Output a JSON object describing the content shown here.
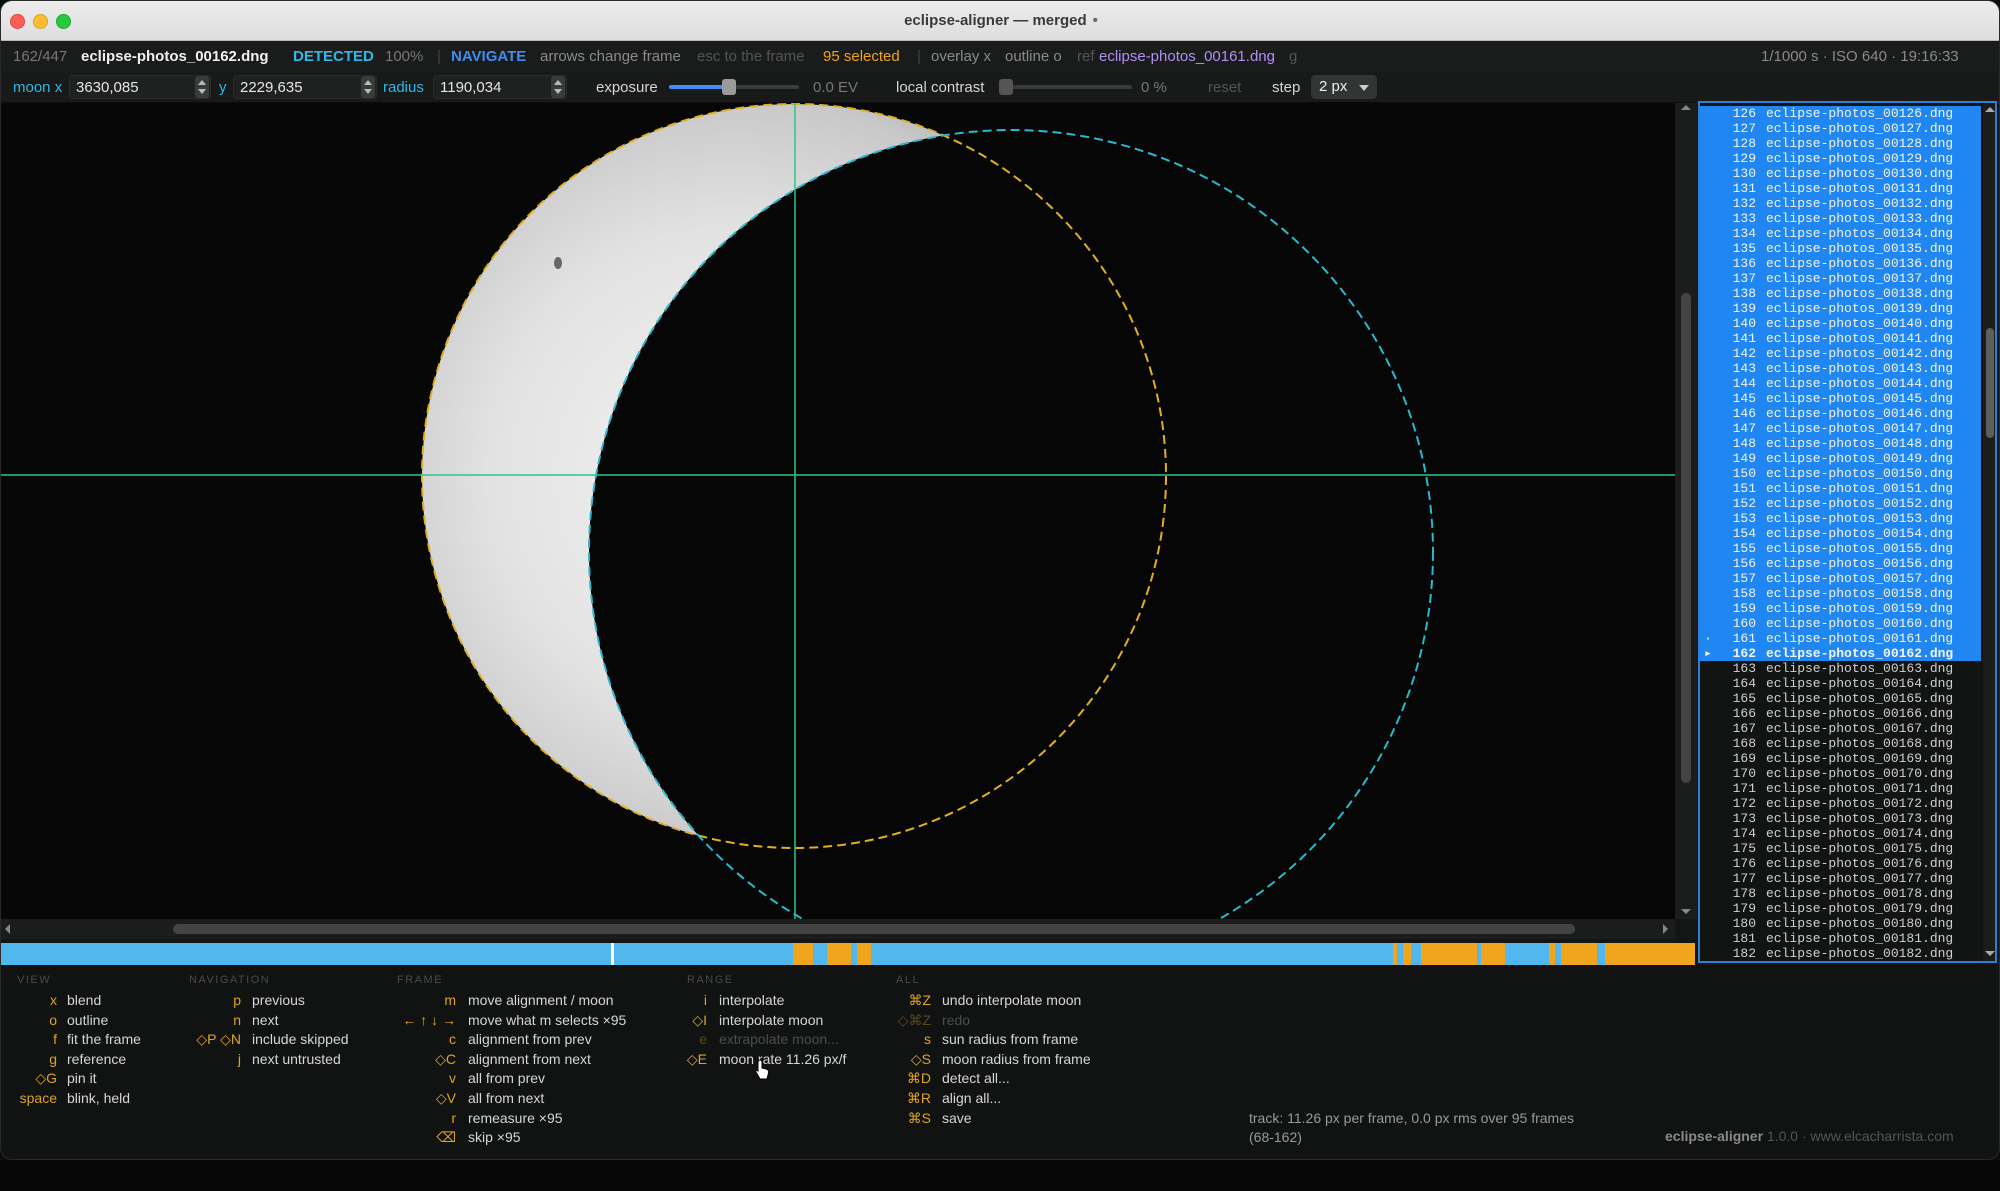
{
  "window": {
    "title": "eclipse-aligner — merged",
    "modified_dot": "•"
  },
  "status": {
    "counter": "162/447",
    "filename": "eclipse-photos_00162.dng",
    "detect_state": "DETECTED",
    "zoom": "100%",
    "mode": "NAVIGATE",
    "hint_arrows": "arrows change frame",
    "hint_esc": "esc to the frame",
    "selected": "95 selected",
    "overlay": "overlay x",
    "outline": "outline o",
    "ref_label": "ref",
    "ref_file": "eclipse-photos_00161.dng",
    "ref_key": "g",
    "exif": "1/1000 s · ISO 640 · 19:16:33"
  },
  "controls": {
    "moonx_label": "moon x",
    "moonx_value": "3630,085",
    "y_label": "y",
    "y_value": "2229,635",
    "radius_label": "radius",
    "radius_value": "1190,034",
    "exposure_label": "exposure",
    "exposure_value": "0.0 EV",
    "exposure_level": 0.5,
    "contrast_label": "local contrast",
    "contrast_value": "0 %",
    "contrast_level": 0,
    "reset_label": "reset",
    "step_label": "step",
    "step_value": "2 px"
  },
  "colors": {
    "sun_outline": "#e0b024",
    "moon_outline": "#2ab8cc",
    "crosshair": "#27c985",
    "accent": "#1f86f2",
    "strip_base": "#50b8ec",
    "strip_mark": "#f0a51e"
  },
  "files": {
    "start": 126,
    "end": 182,
    "prefix": "eclipse-photos_00",
    "ext": ".dng",
    "selected_from": 126,
    "selected_to": 162,
    "current": 162,
    "reference": 161
  },
  "help": {
    "sections": [
      {
        "title": "VIEW",
        "items": [
          {
            "key": "x",
            "desc": "blend"
          },
          {
            "key": "o",
            "desc": "outline"
          },
          {
            "key": "f",
            "desc": "fit the frame"
          },
          {
            "key": "g",
            "desc": "reference"
          },
          {
            "key": "◇G",
            "desc": "pin it"
          },
          {
            "key": "space",
            "desc": "blink, held"
          }
        ]
      },
      {
        "title": "NAVIGATION",
        "items": [
          {
            "key": "p",
            "desc": "previous"
          },
          {
            "key": "n",
            "desc": "next"
          },
          {
            "key": "◇P ◇N",
            "desc": "include skipped"
          },
          {
            "key": "j",
            "desc": "next untrusted"
          }
        ]
      },
      {
        "title": "FRAME",
        "items": [
          {
            "key": "m",
            "desc": "move alignment / moon"
          },
          {
            "key": "← ↑ ↓ →",
            "desc": "move what m selects ×95"
          },
          {
            "key": "c",
            "desc": "alignment from prev"
          },
          {
            "key": "◇C",
            "desc": "alignment from next"
          },
          {
            "key": "v",
            "desc": "all from prev"
          },
          {
            "key": "◇V",
            "desc": "all from next"
          },
          {
            "key": "r",
            "desc": "remeasure ×95"
          },
          {
            "key": "⌫",
            "desc": "skip ×95"
          }
        ]
      },
      {
        "title": "RANGE",
        "items": [
          {
            "key": "i",
            "desc": "interpolate"
          },
          {
            "key": "◇I",
            "desc": "interpolate moon"
          },
          {
            "key": "e",
            "desc": "extrapolate moon...",
            "disabled": true
          },
          {
            "key": "◇E",
            "desc": "moon rate 11.26 px/f"
          }
        ]
      },
      {
        "title": "ALL",
        "items": [
          {
            "key": "⌘Z",
            "desc": "undo interpolate moon"
          },
          {
            "key": "◇⌘Z",
            "desc": "redo",
            "disabled": true
          },
          {
            "key": "s",
            "desc": "sun radius from frame"
          },
          {
            "key": "◇S",
            "desc": "moon radius from frame"
          },
          {
            "key": "⌘D",
            "desc": "detect all..."
          },
          {
            "key": "⌘R",
            "desc": "align all..."
          },
          {
            "key": "⌘S",
            "desc": "save"
          }
        ]
      }
    ],
    "track_line1": "track: 11.26 px per frame, 0.0 px rms over 95 frames",
    "track_line2": "(68-162)",
    "brand_name": "eclipse-aligner",
    "brand_version": "1.0.0 · www.elcacharrista.com"
  }
}
